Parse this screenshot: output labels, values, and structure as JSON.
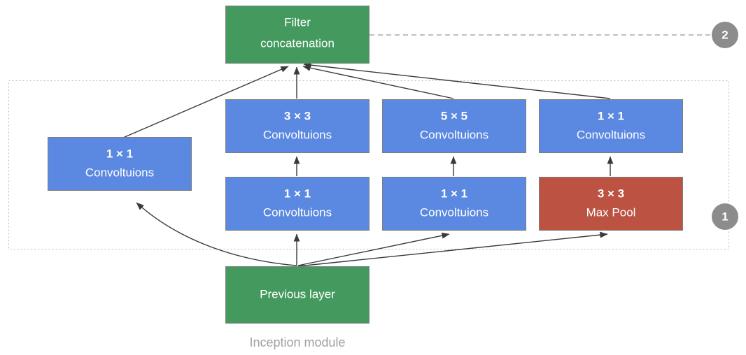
{
  "diagram": {
    "caption": "Inception module",
    "colors": {
      "green": "#449a5e",
      "blue": "#5b88e0",
      "red": "#bc5242",
      "box_stroke": "#7d7d7d",
      "edge": "#3a3a3a",
      "dashed_group": "#b8b8b8",
      "badge_gray": "#8c8c8c",
      "caption_gray": "#a0a0a0",
      "label_white": "#ffffff"
    },
    "nodes": {
      "filter_concatenation": {
        "line1": "Filter",
        "line2": "concatenation",
        "color": "#449a5e"
      },
      "previous_layer": {
        "line1": "Previous layer",
        "line2": "",
        "color": "#449a5e"
      },
      "conv_1x1_left": {
        "line1": "1 × 1",
        "line2": "Convoltuions",
        "color": "#5b88e0"
      },
      "conv_3x3_top": {
        "line1": "3 × 3",
        "line2": "Convoltuions",
        "color": "#5b88e0"
      },
      "conv_5x5_top": {
        "line1": "5 × 5",
        "line2": "Convoltuions",
        "color": "#5b88e0"
      },
      "conv_1x1_top_right": {
        "line1": "1 × 1",
        "line2": "Convoltuions",
        "color": "#5b88e0"
      },
      "conv_1x1_mid_a": {
        "line1": "1 × 1",
        "line2": "Convoltuions",
        "color": "#5b88e0"
      },
      "conv_1x1_mid_b": {
        "line1": "1 × 1",
        "line2": "Convoltuions",
        "color": "#5b88e0"
      },
      "max_pool_3x3": {
        "line1": "3 × 3",
        "line2": "Max Pool",
        "color": "#bc5242"
      }
    },
    "badges": [
      {
        "label": "1",
        "name": "badge-one"
      },
      {
        "label": "2",
        "name": "badge-two"
      }
    ]
  }
}
